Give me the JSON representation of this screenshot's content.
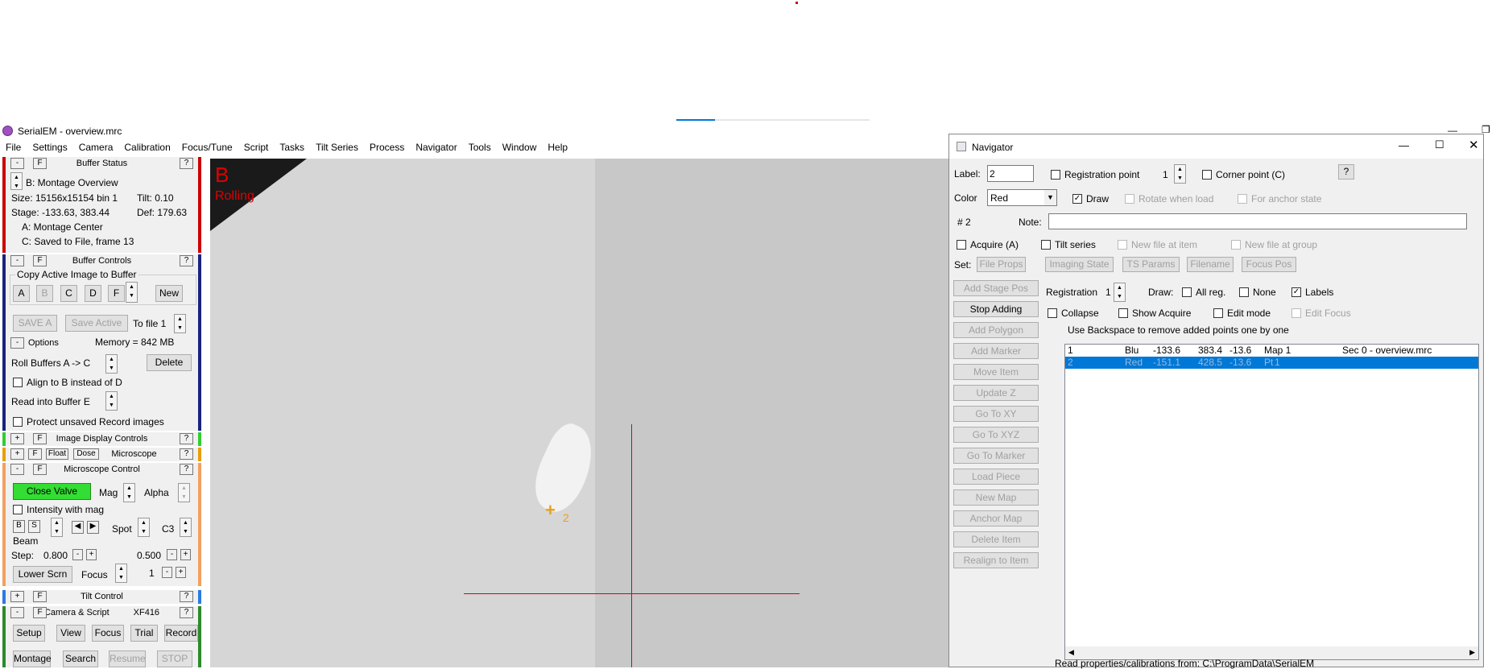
{
  "window": {
    "app_title": "SerialEM  -  overview.mrc"
  },
  "menu": [
    "File",
    "Settings",
    "Camera",
    "Calibration",
    "Focus/Tune",
    "Script",
    "Tasks",
    "Tilt Series",
    "Process",
    "Navigator",
    "Tools",
    "Window",
    "Help"
  ],
  "buffer_status": {
    "title": "Buffer Status",
    "buffer": "B: Montage Overview",
    "size": "Size: 15156x15154  bin 1",
    "tilt": "Tilt: 0.10",
    "stage": "Stage: -133.63, 383.44",
    "def": "Def: 179.63",
    "a": "A: Montage Center",
    "c": "C: Saved to File, frame 13"
  },
  "buffer_controls": {
    "title": "Buffer Controls",
    "group": "Copy Active Image to Buffer",
    "buttons": [
      "A",
      "B",
      "C",
      "D",
      "F",
      "New"
    ],
    "save_a": "SAVE A",
    "save_active": "Save Active",
    "to_file": "To file 1",
    "options": "Options",
    "memory": "Memory = 842 MB",
    "roll": "Roll Buffers A ->  C",
    "delete": "Delete",
    "align": "Align to B instead of D",
    "read_into": "Read into Buffer   E",
    "protect": "Protect unsaved Record images"
  },
  "image_display": {
    "title": "Image Display Controls"
  },
  "small_bar": {
    "float": "Float",
    "dose": "Dose",
    "microscope": "Microscope"
  },
  "microscope": {
    "title": "Microscope Control",
    "close_valve": "Close Valve",
    "mag": "Mag",
    "alpha": "Alpha",
    "intensity": "Intensity with mag",
    "beam": "Beam",
    "spot": "Spot",
    "c3": "C3",
    "step_label": "Step:",
    "step1": "0.800",
    "step2": "0.500",
    "lower": "Lower Scrn",
    "focus": "Focus",
    "focus_val": "1"
  },
  "tilt_control": {
    "title": "Tilt Control"
  },
  "camera_script": {
    "title": "Camera & Script",
    "camera": "XF416",
    "row1": [
      "Setup",
      "View",
      "Focus",
      "Trial",
      "Record"
    ],
    "row2": [
      "Montage",
      "Search",
      "Resume",
      "STOP"
    ]
  },
  "image": {
    "buffer": "B",
    "status": "Rolling",
    "marker_label": "2"
  },
  "navigator": {
    "title": "Navigator",
    "label_label": "Label:",
    "label_value": "2",
    "reg_point": "Registration point",
    "reg_val": "1",
    "corner": "Corner point (C)",
    "help": "?",
    "color_label": "Color",
    "color_value": "Red",
    "draw": "Draw",
    "rotate": "Rotate when load",
    "anchor": "For anchor state",
    "num": "# 2",
    "note": "Note:",
    "acquire": "Acquire (A)",
    "tilt_series": "Tilt series",
    "new_file_item": "New file at item",
    "new_file_group": "New file at group",
    "set": "Set:",
    "set_buttons": [
      "File Props",
      "Imaging State",
      "TS Params",
      "Filename",
      "Focus Pos"
    ],
    "left_buttons": [
      "Add Stage Pos",
      "Stop Adding",
      "Add Polygon",
      "Add Marker",
      "Move Item",
      "Update Z",
      "Go To XY",
      "Go To XYZ",
      "Go To Marker",
      "Load Piece",
      "New Map",
      "Anchor Map",
      "Delete Item",
      "Realign to Item"
    ],
    "registration": "Registration",
    "reg2": "1",
    "draw2": "Draw:",
    "all_reg": "All reg.",
    "none": "None",
    "labels": "Labels",
    "collapse": "Collapse",
    "show_acquire": "Show Acquire",
    "edit_mode": "Edit mode",
    "edit_focus": "Edit Focus",
    "hint": "Use Backspace to remove added points one by one",
    "rows": [
      [
        "1",
        "Blu",
        "-133.6",
        "383.4",
        "-13.6",
        "Map 1",
        "Sec 0 - overview.mrc"
      ],
      [
        "2",
        "Red",
        "-151.1",
        "428.5",
        "-13.6",
        "Pt",
        "1"
      ]
    ],
    "log": "Read properties/calibrations from: C:\\ProgramData\\SerialEM"
  },
  "colors": {
    "accent": "#0078d7",
    "valve": "#33dd33",
    "crosshair": "#e00000"
  }
}
